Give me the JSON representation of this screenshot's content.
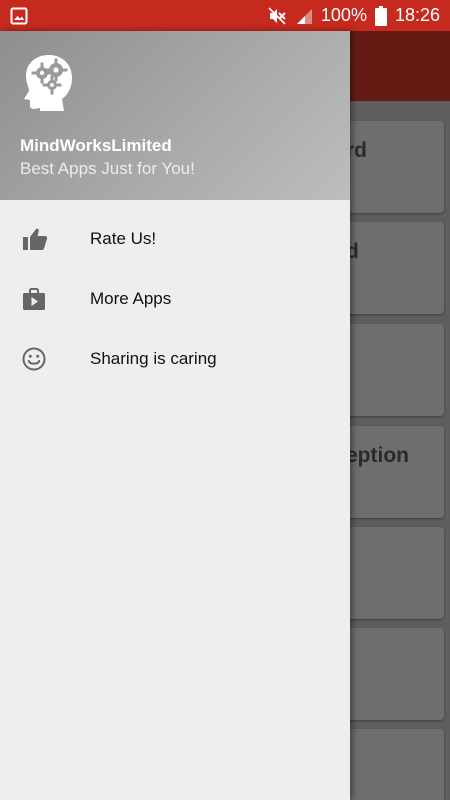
{
  "status_bar": {
    "battery": "100%",
    "time": "18:26",
    "icons": [
      "image-icon",
      "mute-icon",
      "signal-icon",
      "battery-icon"
    ]
  },
  "background": {
    "cards": [
      {
        "title": "rd"
      },
      {
        "title": "d"
      },
      {
        "title": ""
      },
      {
        "title": "eption"
      },
      {
        "title": ""
      },
      {
        "title": ""
      },
      {
        "title": ""
      }
    ]
  },
  "drawer": {
    "header": {
      "app_name": "MindWorksLimited",
      "tagline": "Best Apps Just for You!",
      "logo_icon": "brain-gears-icon"
    },
    "menu": [
      {
        "label": "Rate Us!",
        "icon": "thumb-up-icon"
      },
      {
        "label": "More Apps",
        "icon": "shop-bag-icon"
      },
      {
        "label": "Sharing is caring",
        "icon": "smiley-icon"
      }
    ]
  },
  "colors": {
    "status_bar": "#c62a1e",
    "drawer_bg": "#eeeeee",
    "toolbar_dimmed": "#631b14"
  }
}
